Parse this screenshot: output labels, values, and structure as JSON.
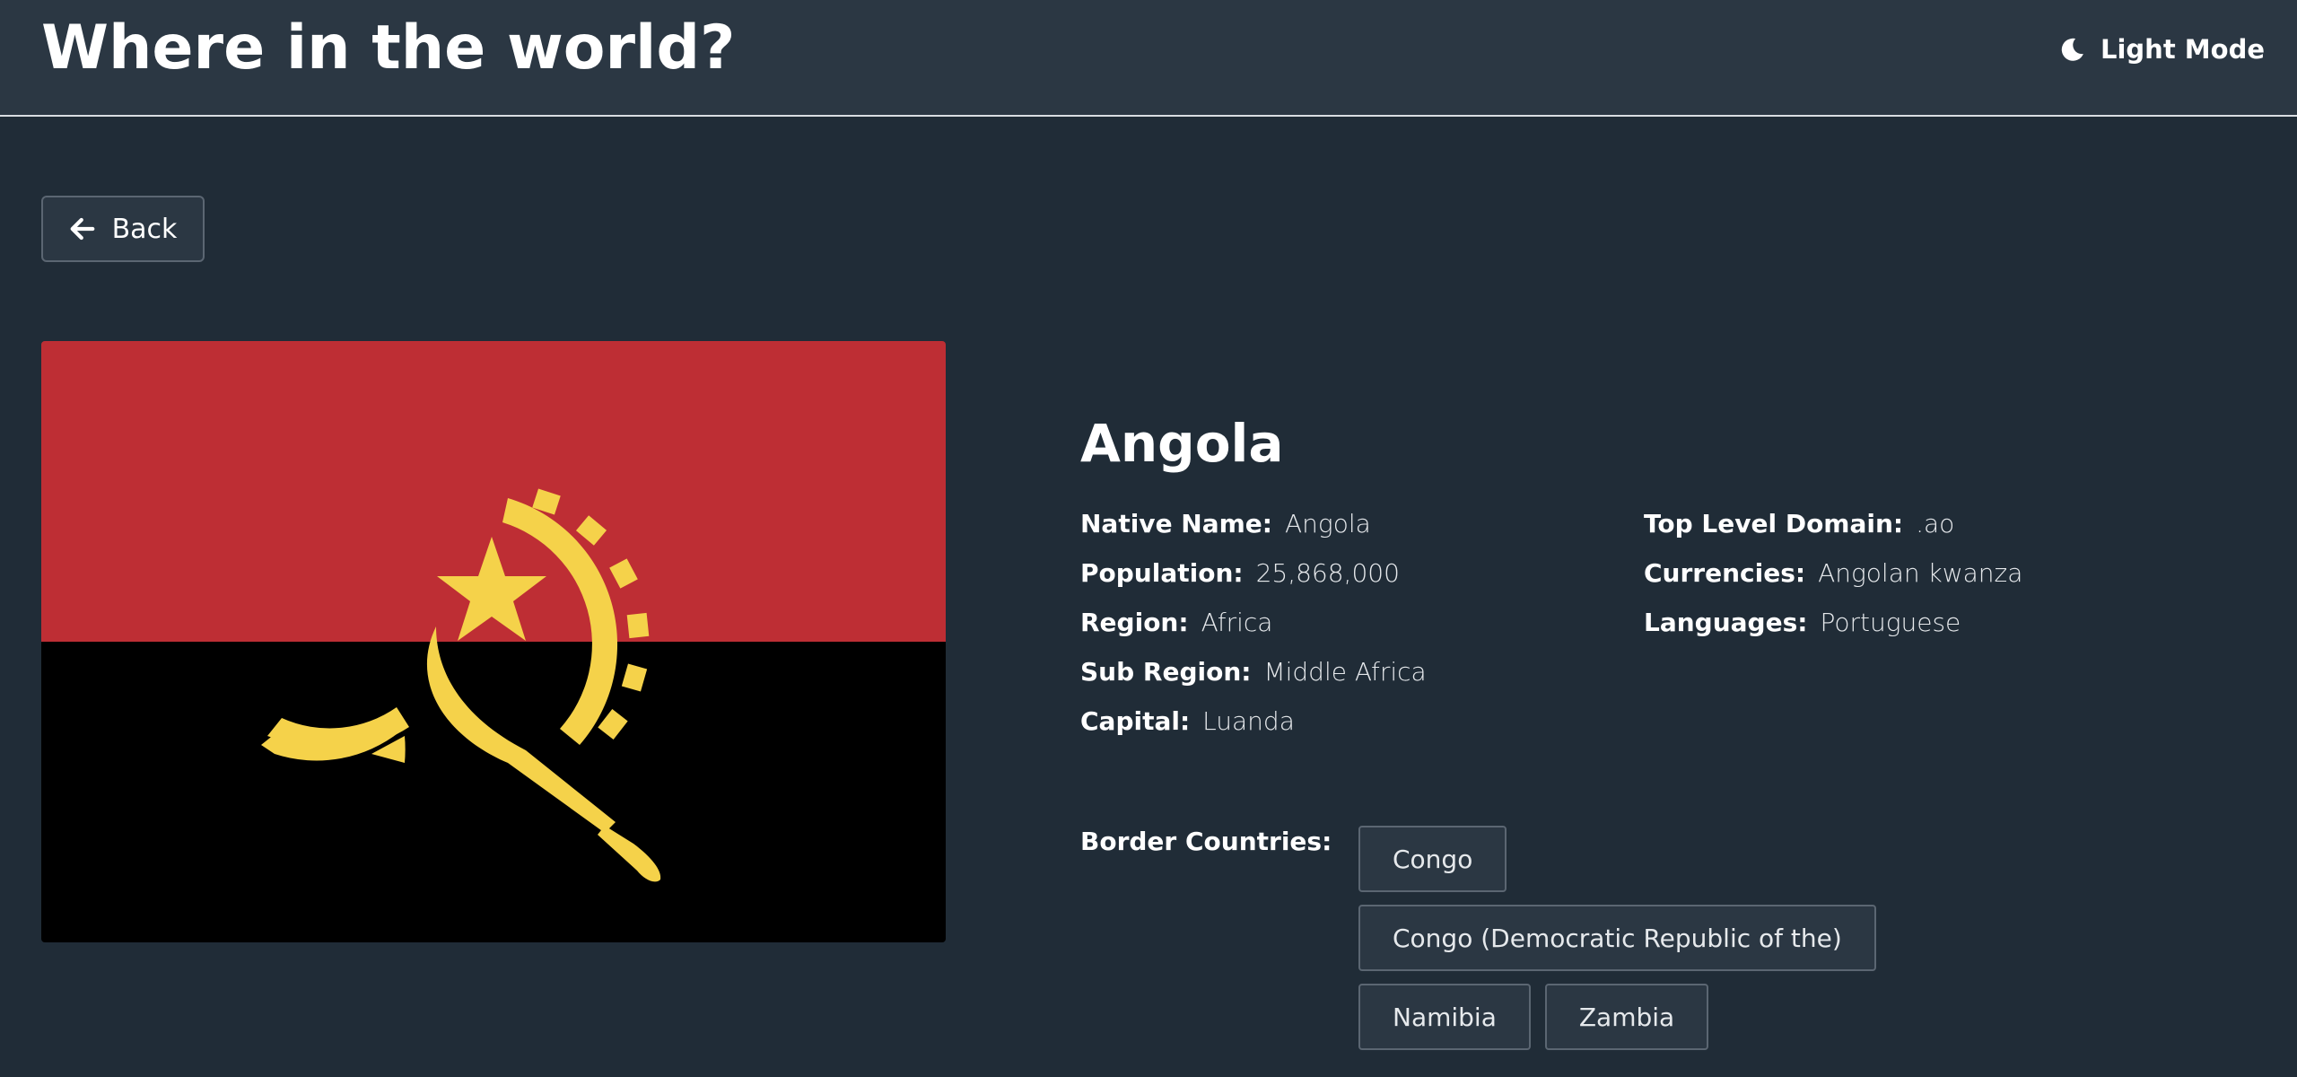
{
  "header": {
    "title": "Where in the world?",
    "theme_toggle": {
      "label": "Light Mode",
      "icon": "moon-icon"
    }
  },
  "back_button": {
    "label": "Back",
    "icon": "arrow-left-icon"
  },
  "flag": {
    "country": "Angola",
    "colors": {
      "top": "#be2e34",
      "bottom": "#000000",
      "emblem": "#f5d24a"
    }
  },
  "country": {
    "name": "Angola",
    "details_left": [
      {
        "label": "Native Name:",
        "value": "Angola"
      },
      {
        "label": "Population:",
        "value": "25,868,000"
      },
      {
        "label": "Region:",
        "value": "Africa"
      },
      {
        "label": "Sub Region:",
        "value": "Middle Africa"
      },
      {
        "label": "Capital:",
        "value": "Luanda"
      }
    ],
    "details_right": [
      {
        "label": "Top Level Domain:",
        "value": ".ao"
      },
      {
        "label": "Currencies:",
        "value": "Angolan kwanza"
      },
      {
        "label": "Languages:",
        "value": "Portuguese"
      }
    ]
  },
  "borders": {
    "label": "Border Countries:",
    "countries": [
      "Congo",
      "Congo (Democratic Republic of the)",
      "Namibia",
      "Zambia"
    ]
  },
  "colors": {
    "background": "#202c37",
    "surface": "#2b3743",
    "text": "#ffffff"
  }
}
